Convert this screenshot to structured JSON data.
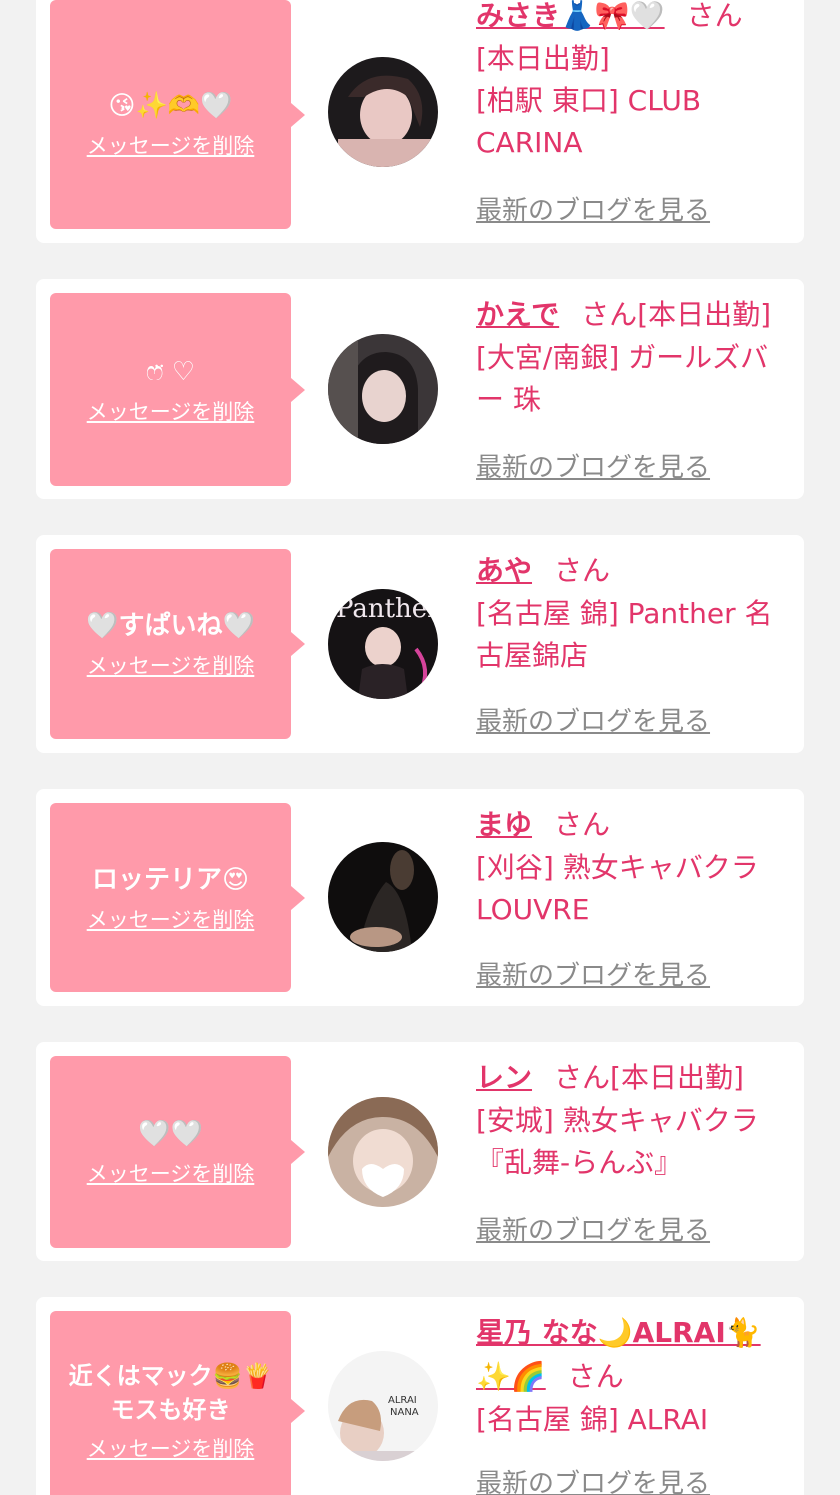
{
  "colors": {
    "page_bg": "#f2f2f2",
    "card_bg": "#ffffff",
    "bubble_bg": "#ff9aaa",
    "accent": "#e2356a",
    "link_gray": "#8a8a8a"
  },
  "labels": {
    "delete": "メッセージを削除",
    "blog": "最新のブログを見る",
    "honorific": "さん"
  },
  "cards": [
    {
      "message": "😘✨🫶🤍",
      "name": "みさき👗🎀🤍",
      "tag": "[本日出勤]",
      "shop": "[柏駅 東口] CLUB CARINA"
    },
    {
      "message": "ෆ̈ ♡",
      "name": "かえで",
      "tag": "[本日出勤]",
      "shop": "[大宮/南銀] ガールズバー 珠"
    },
    {
      "message": "🤍すぱいね🤍",
      "name": "あや",
      "tag": "",
      "shop": "[名古屋 錦] Panther 名古屋錦店"
    },
    {
      "message": "ロッテリア😍",
      "name": "まゆ",
      "tag": "",
      "shop": "[刈谷] 熟女キャバクラ LOUVRE"
    },
    {
      "message": "🤍🤍",
      "name": "レン",
      "tag": "[本日出勤]",
      "shop": "[安城] 熟女キャバクラ『乱舞-らんぶ』"
    },
    {
      "message": "近くはマック🍔🍟モスも好き",
      "name": "星乃 なな🌙ALRAI🐈✨🌈",
      "tag": "",
      "shop": "[名古屋 錦] ALRAI"
    }
  ]
}
